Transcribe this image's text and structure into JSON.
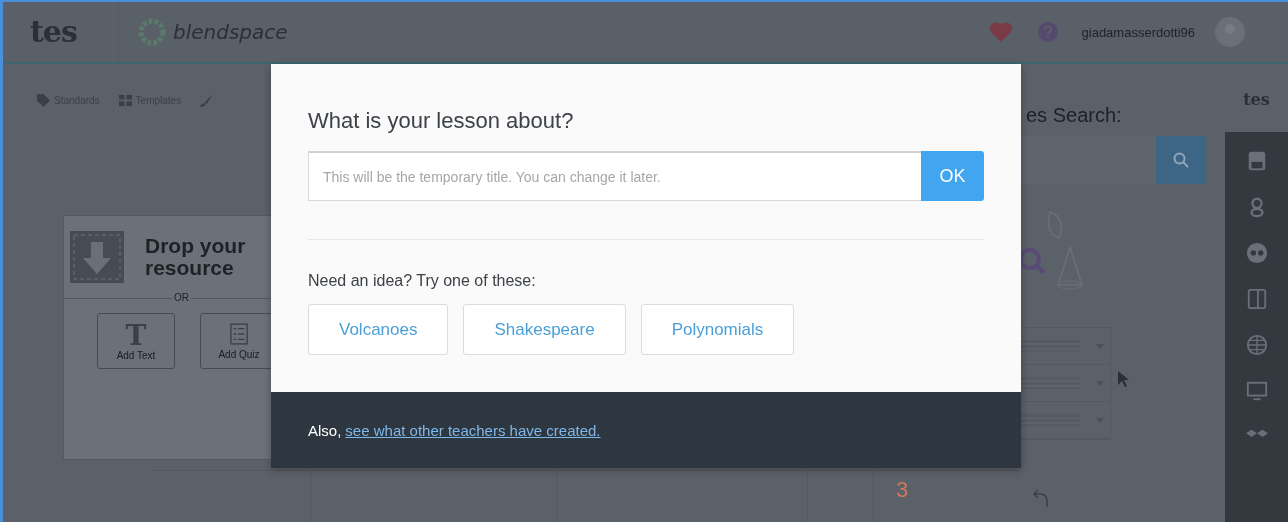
{
  "header": {
    "logo": "tes",
    "app_name": "blendspace",
    "username": "giadamasserdotti96"
  },
  "toolbar": [
    {
      "label": "Standards",
      "kind": "tag"
    },
    {
      "label": "Templates",
      "kind": "grid"
    },
    {
      "kind": "brush"
    }
  ],
  "drop_area": {
    "title": "Drop your resource",
    "divider": "OR",
    "buttons": [
      {
        "label": "Add Text",
        "kind": "text",
        "icon_text": "T"
      },
      {
        "label": "Add Quiz",
        "kind": "quiz"
      }
    ]
  },
  "search": {
    "label": "es Search:"
  },
  "sidebar": {
    "logo": "tes"
  },
  "bottom": {
    "number": "3"
  },
  "modal": {
    "title": "What is your lesson about?",
    "input": {
      "placeholder": "This will be the temporary title. You can change it later."
    },
    "ok_button": "OK",
    "ideas_label": "Need an idea? Try one of these:",
    "ideas": [
      "Volcanoes",
      "Shakespeare",
      "Polynomials"
    ],
    "footer": {
      "text": "Also,",
      "link": "see what other teachers have created."
    }
  }
}
